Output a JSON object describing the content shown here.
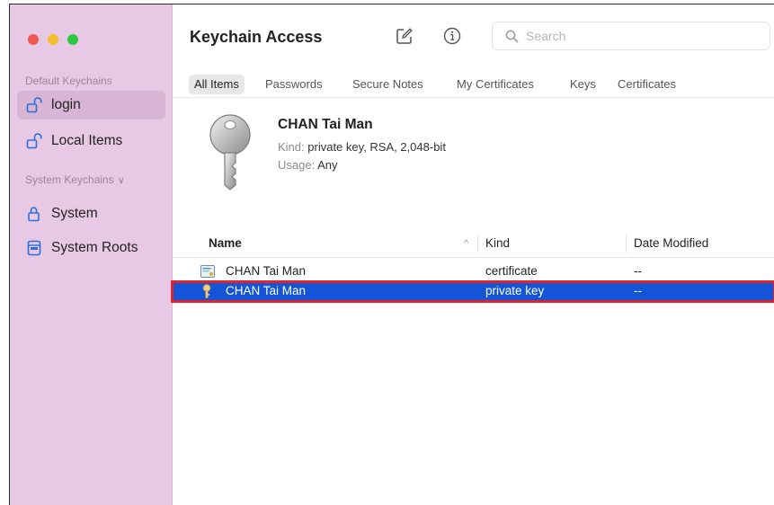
{
  "sidebar": {
    "default_header": "Default Keychains",
    "system_header": "System Keychains",
    "system_chevron": "∨",
    "items": [
      {
        "label": "login",
        "icon": "unlock-icon"
      },
      {
        "label": "Local Items",
        "icon": "unlock-icon"
      },
      {
        "label": "System",
        "icon": "lock-icon"
      },
      {
        "label": "System Roots",
        "icon": "cabinet-icon"
      }
    ]
  },
  "toolbar": {
    "title": "Keychain Access",
    "search_placeholder": "Search"
  },
  "tabs": [
    "All Items",
    "Passwords",
    "Secure Notes",
    "My Certificates",
    "Keys",
    "Certificates"
  ],
  "preview": {
    "name": "CHAN Tai Man",
    "kind_label": "Kind:",
    "kind_value": "private key, RSA, 2,048-bit",
    "usage_label": "Usage:",
    "usage_value": "Any"
  },
  "table": {
    "columns": [
      "Name",
      "Kind",
      "Date Modified"
    ],
    "sort_indicator": "^",
    "rows": [
      {
        "name": "CHAN Tai Man",
        "kind": "certificate",
        "date": "--",
        "icon": "certificate-icon"
      },
      {
        "name": "CHAN Tai Man",
        "kind": "private key",
        "date": "--",
        "icon": "key-icon"
      }
    ]
  },
  "colors": {
    "sidebar_bg": "#e7c9e5",
    "selection_blue": "#1454d6",
    "highlight_red": "#e2232a"
  }
}
